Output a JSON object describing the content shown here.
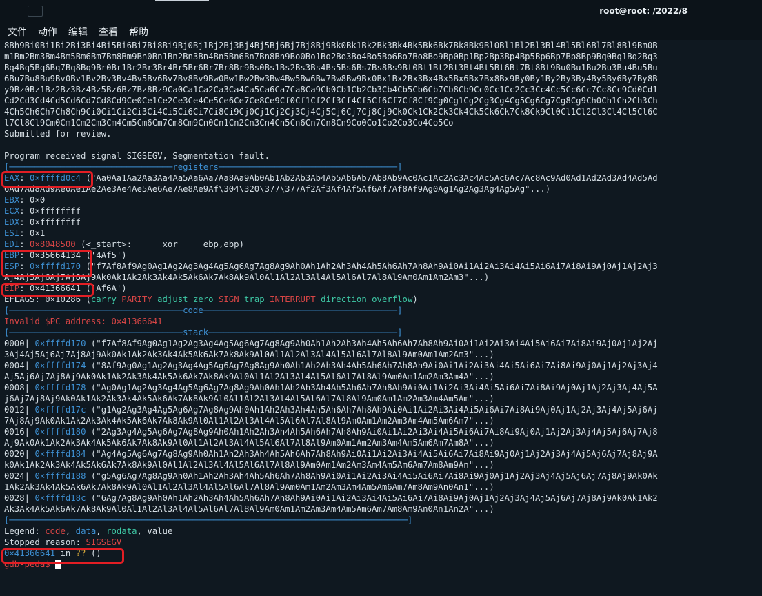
{
  "window": {
    "title": "root@root: /2022/8"
  },
  "menu": {
    "file": "文件",
    "action": "动作",
    "edit": "编辑",
    "view": "查看",
    "help": "帮助"
  },
  "pattern": [
    "8Bh9Bi0Bi1Bi2Bi3Bi4Bi5Bi6Bi7Bi8Bi9Bj0Bj1Bj2Bj3Bj4Bj5Bj6Bj7Bj8Bj9Bk0Bk1Bk2Bk3Bk4Bk5Bk6Bk7Bk8Bk9Bl0Bl1Bl2Bl3Bl4Bl5Bl6Bl7Bl8Bl9Bm0B",
    "m1Bm2Bm3Bm4Bm5Bm6Bm7Bm8Bm9Bn0Bn1Bn2Bn3Bn4Bn5Bn6Bn7Bn8Bn9Bo0Bo1Bo2Bo3Bo4Bo5Bo6Bo7Bo8Bo9Bp0Bp1Bp2Bp3Bp4Bp5Bp6Bp7Bp8Bp9Bq0Bq1Bq2Bq3",
    "Bq4Bq5Bq6Bq7Bq8Bq9Br0Br1Br2Br3Br4Br5Br6Br7Br8Br9Bs0Bs1Bs2Bs3Bs4Bs5Bs6Bs7Bs8Bs9Bt0Bt1Bt2Bt3Bt4Bt5Bt6Bt7Bt8Bt9Bu0Bu1Bu2Bu3Bu4Bu5Bu",
    "6Bu7Bu8Bu9Bv0Bv1Bv2Bv3Bv4Bv5Bv6Bv7Bv8Bv9Bw0Bw1Bw2Bw3Bw4Bw5Bw6Bw7Bw8Bw9Bx0Bx1Bx2Bx3Bx4Bx5Bx6Bx7Bx8Bx9By0By1By2By3By4By5By6By7By8B",
    "y9Bz0Bz1Bz2Bz3Bz4Bz5Bz6Bz7Bz8Bz9Ca0Ca1Ca2Ca3Ca4Ca5Ca6Ca7Ca8Ca9Cb0Cb1Cb2Cb3Cb4Cb5Cb6Cb7Cb8Cb9Cc0Cc1Cc2Cc3Cc4Cc5Cc6Cc7Cc8Cc9Cd0Cd1",
    "Cd2Cd3Cd4Cd5Cd6Cd7Cd8Cd9Ce0Ce1Ce2Ce3Ce4Ce5Ce6Ce7Ce8Ce9Cf0Cf1Cf2Cf3Cf4Cf5Cf6Cf7Cf8Cf9Cg0Cg1Cg2Cg3Cg4Cg5Cg6Cg7Cg8Cg9Ch0Ch1Ch2Ch3Ch",
    "4Ch5Ch6Ch7Ch8Ch9Ci0Ci1Ci2Ci3Ci4Ci5Ci6Ci7Ci8Ci9Cj0Cj1Cj2Cj3Cj4Cj5Cj6Cj7Cj8Cj9Ck0Ck1Ck2Ck3Ck4Ck5Ck6Ck7Ck8Ck9Cl0Cl1Cl2Cl3Cl4Cl5Cl6C",
    "l7Cl8Cl9Cm0Cm1Cm2Cm3Cm4Cm5Cm6Cm7Cm8Cm9Cn0Cn1Cn2Cn3Cn4Cn5Cn6Cn7Cn8Cn9Co0Co1Co2Co3Co4Co5Co"
  ],
  "submitted": "Submitted for review.",
  "signal": "Program received signal SIGSEGV, Segmentation fault.",
  "sep_registers": "[────────────────────────────────registers───────────────────────────────────]",
  "eax": {
    "label": "EAX",
    "addr": "0×ffffd0c4",
    "val1": " (\"Aa0Aa1Aa2Aa3Aa4Aa5Aa6Aa7Aa8Aa9Ab0Ab1Ab2Ab3Ab4Ab5Ab6Ab7Ab8Ab9Ac0Ac1Ac2Ac3Ac4Ac5Ac6Ac7Ac8Ac9Ad0Ad1Ad2Ad3Ad4Ad5Ad",
    "val2": "6Ad7Ad8Ad9Ae0Ae1Ae2Ae3Ae4Ae5Ae6Ae7Ae8Ae9Af\\304\\320\\377\\377Af2Af3Af4Af5Af6Af7Af8Af9Ag0Ag1Ag2Ag3Ag4Ag5Ag\"...)"
  },
  "ebx": {
    "label": "EBX",
    "val": ": 0×0"
  },
  "ecx": {
    "label": "ECX",
    "val": ": 0×ffffffff"
  },
  "edx": {
    "label": "EDX",
    "val": ": 0×ffffffff"
  },
  "esi": {
    "label": "ESI",
    "val": ": 0×1"
  },
  "edi": {
    "label": "EDI",
    "addr": "0×8048500",
    "val": " (<_start>:      xor     ebp,ebp)"
  },
  "ebp": {
    "label": "EBP",
    "val": ": 0×35664134 ('4Af5')"
  },
  "esp": {
    "label": "ESP",
    "addr": "0×ffffd170",
    "val1": " (\"f7Af8Af9Ag0Ag1Ag2Ag3Ag4Ag5Ag6Ag7Ag8Ag9Ah0Ah1Ah2Ah3Ah4Ah5Ah6Ah7Ah8Ah9Ai0Ai1Ai2Ai3Ai4Ai5Ai6Ai7Ai8Ai9Aj0Aj1Aj2Aj3",
    "val2": "Aj4Aj5Aj6Aj7Aj8Aj9Ak0Ak1Ak2Ak3Ak4Ak5Ak6Ak7Ak8Ak9Al0Al1Al2Al3Al4Al5Al6Al7Al8Al9Am0Am1Am2Am3\"...)"
  },
  "eip": {
    "label": "EIP",
    "val": ": 0×41366641 ('Af6A')"
  },
  "eflags": {
    "label": "EFLAGS",
    "val": ": 0×10286 (",
    "carry": "carry",
    "parity": "PARITY",
    "adjust": "adjust",
    "zero": "zero",
    "sign": "SIGN",
    "trap": "trap",
    "interrupt": "INTERRUPT",
    "direction": "direction",
    "overflow": "overflow",
    "close": ")"
  },
  "sep_code": "[──────────────────────────────────code──────────────────────────────────────]",
  "invalid_pc": "Invalid $PC address: 0×41366641",
  "sep_stack": "[──────────────────────────────────stack─────────────────────────────────────]",
  "stack": [
    {
      "off": "0000|",
      "addr": "0×ffffd170",
      "v1": " (\"f7Af8Af9Ag0Ag1Ag2Ag3Ag4Ag5Ag6Ag7Ag8Ag9Ah0Ah1Ah2Ah3Ah4Ah5Ah6Ah7Ah8Ah9Ai0Ai1Ai2Ai3Ai4Ai5Ai6Ai7Ai8Ai9Aj0Aj1Aj2Aj",
      "v2": "3Aj4Aj5Aj6Aj7Aj8Aj9Ak0Ak1Ak2Ak3Ak4Ak5Ak6Ak7Ak8Ak9Al0Al1Al2Al3Al4Al5Al6Al7Al8Al9Am0Am1Am2Am3\"...)"
    },
    {
      "off": "0004|",
      "addr": "0×ffffd174",
      "v1": " (\"8Af9Ag0Ag1Ag2Ag3Ag4Ag5Ag6Ag7Ag8Ag9Ah0Ah1Ah2Ah3Ah4Ah5Ah6Ah7Ah8Ah9Ai0Ai1Ai2Ai3Ai4Ai5Ai6Ai7Ai8Ai9Aj0Aj1Aj2Aj3Aj4",
      "v2": "Aj5Aj6Aj7Aj8Aj9Ak0Ak1Ak2Ak3Ak4Ak5Ak6Ak7Ak8Ak9Al0Al1Al2Al3Al4Al5Al6Al7Al8Al9Am0Am1Am2Am3Am4A\"...)"
    },
    {
      "off": "0008|",
      "addr": "0×ffffd178",
      "v1": " (\"Ag0Ag1Ag2Ag3Ag4Ag5Ag6Ag7Ag8Ag9Ah0Ah1Ah2Ah3Ah4Ah5Ah6Ah7Ah8Ah9Ai0Ai1Ai2Ai3Ai4Ai5Ai6Ai7Ai8Ai9Aj0Aj1Aj2Aj3Aj4Aj5A",
      "v2": "j6Aj7Aj8Aj9Ak0Ak1Ak2Ak3Ak4Ak5Ak6Ak7Ak8Ak9Al0Al1Al2Al3Al4Al5Al6Al7Al8Al9Am0Am1Am2Am3Am4Am5Am\"...)"
    },
    {
      "off": "0012|",
      "addr": "0×ffffd17c",
      "v1": " (\"g1Ag2Ag3Ag4Ag5Ag6Ag7Ag8Ag9Ah0Ah1Ah2Ah3Ah4Ah5Ah6Ah7Ah8Ah9Ai0Ai1Ai2Ai3Ai4Ai5Ai6Ai7Ai8Ai9Aj0Aj1Aj2Aj3Aj4Aj5Aj6Aj",
      "v2": "7Aj8Aj9Ak0Ak1Ak2Ak3Ak4Ak5Ak6Ak7Ak8Ak9Al0Al1Al2Al3Al4Al5Al6Al7Al8Al9Am0Am1Am2Am3Am4Am5Am6Am7\"...)"
    },
    {
      "off": "0016|",
      "addr": "0×ffffd180",
      "v1": " (\"2Ag3Ag4Ag5Ag6Ag7Ag8Ag9Ah0Ah1Ah2Ah3Ah4Ah5Ah6Ah7Ah8Ah9Ai0Ai1Ai2Ai3Ai4Ai5Ai6Ai7Ai8Ai9Aj0Aj1Aj2Aj3Aj4Aj5Aj6Aj7Aj8",
      "v2": "Aj9Ak0Ak1Ak2Ak3Ak4Ak5Ak6Ak7Ak8Ak9Al0Al1Al2Al3Al4Al5Al6Al7Al8Al9Am0Am1Am2Am3Am4Am5Am6Am7Am8A\"...)"
    },
    {
      "off": "0020|",
      "addr": "0×ffffd184",
      "v1": " (\"Ag4Ag5Ag6Ag7Ag8Ag9Ah0Ah1Ah2Ah3Ah4Ah5Ah6Ah7Ah8Ah9Ai0Ai1Ai2Ai3Ai4Ai5Ai6Ai7Ai8Ai9Aj0Aj1Aj2Aj3Aj4Aj5Aj6Aj7Aj8Aj9A",
      "v2": "k0Ak1Ak2Ak3Ak4Ak5Ak6Ak7Ak8Ak9Al0Al1Al2Al3Al4Al5Al6Al7Al8Al9Am0Am1Am2Am3Am4Am5Am6Am7Am8Am9An\"...)"
    },
    {
      "off": "0024|",
      "addr": "0×ffffd188",
      "v1": " (\"g5Ag6Ag7Ag8Ag9Ah0Ah1Ah2Ah3Ah4Ah5Ah6Ah7Ah8Ah9Ai0Ai1Ai2Ai3Ai4Ai5Ai6Ai7Ai8Ai9Aj0Aj1Aj2Aj3Aj4Aj5Aj6Aj7Aj8Aj9Ak0Ak",
      "v2": "1Ak2Ak3Ak4Ak5Ak6Ak7Ak8Ak9Al0Al1Al2Al3Al4Al5Al6Al7Al8Al9Am0Am1Am2Am3Am4Am5Am6Am7Am8Am9An0An1\"...)"
    },
    {
      "off": "0028|",
      "addr": "0×ffffd18c",
      "v1": " (\"6Ag7Ag8Ag9Ah0Ah1Ah2Ah3Ah4Ah5Ah6Ah7Ah8Ah9Ai0Ai1Ai2Ai3Ai4Ai5Ai6Ai7Ai8Ai9Aj0Aj1Aj2Aj3Aj4Aj5Aj6Aj7Aj8Aj9Ak0Ak1Ak2",
      "v2": "Ak3Ak4Ak5Ak6Ak7Ak8Ak9Al0Al1Al2Al3Al4Al5Al6Al7Al8Al9Am0Am1Am2Am3Am4Am5Am6Am7Am8Am9An0An1An2A\"...)"
    }
  ],
  "sep_end": "[──────────────────────────────────────────────────────────────────────────────]",
  "legend": {
    "label": "Legend: ",
    "code": "code",
    "data": "data",
    "rodata": "rodata",
    "value": "value",
    "comma": ", "
  },
  "stopped": {
    "label": "Stopped reason: ",
    "reason": "SIGSEGV"
  },
  "frame": {
    "addr": "0×41366641",
    "in": " in ",
    "func": "??",
    "args": " ()"
  },
  "prompt": "gdb-peda$ ",
  "colors": {
    "background": "#0f1820",
    "code": "#d64545",
    "data": "#3d8fd1",
    "rodata": "#3ec9a6",
    "highlight": "#e31e24"
  }
}
